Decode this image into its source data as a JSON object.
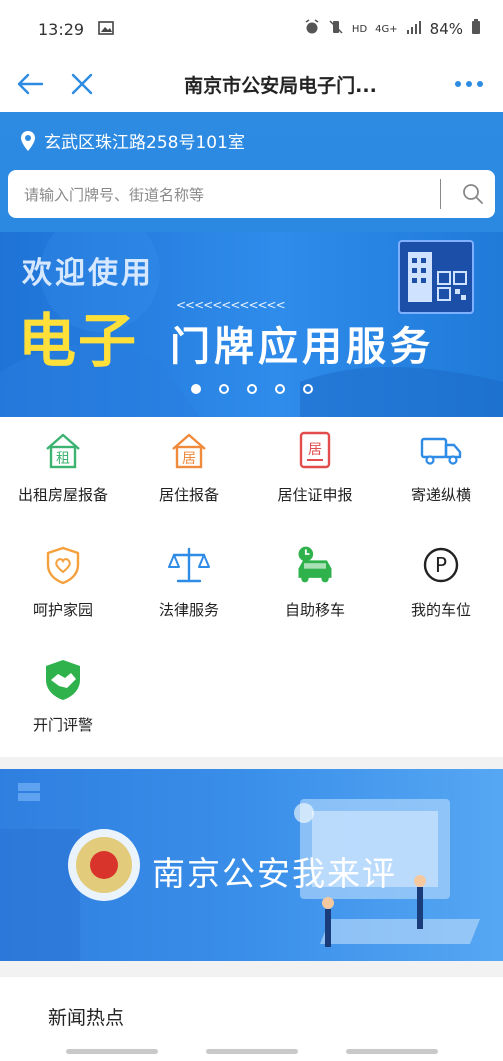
{
  "status_bar": {
    "time": "13:29",
    "battery": "84%",
    "network": "4G+",
    "hd": "HD"
  },
  "app_bar": {
    "title": "南京市公安局电子门..."
  },
  "header": {
    "address": "玄武区珠江路258号101室",
    "search_placeholder": "请输入门牌号、街道名称等"
  },
  "banner": {
    "welcome": "欢迎使用",
    "title_big": "电子",
    "title_rest": "门牌应用服务",
    "chevrons": "<<<<<<<<<<<<",
    "page_count": 5,
    "active_page": 1
  },
  "services": [
    {
      "label": "出租房屋报备",
      "icon": "house-rent-icon",
      "color": "#3cb371"
    },
    {
      "label": "居住报备",
      "icon": "house-reside-icon",
      "color": "#f08a3c"
    },
    {
      "label": "居住证申报",
      "icon": "residence-permit-icon",
      "color": "#e24c4c"
    },
    {
      "label": "寄递纵横",
      "icon": "delivery-truck-icon",
      "color": "#2e8be6"
    },
    {
      "label": "呵护家园",
      "icon": "heart-shield-icon",
      "color": "#f5a03c"
    },
    {
      "label": "法律服务",
      "icon": "scales-icon",
      "color": "#2e8be6"
    },
    {
      "label": "自助移车",
      "icon": "car-clock-icon",
      "color": "#2fb24c"
    },
    {
      "label": "我的车位",
      "icon": "parking-icon",
      "color": "#222222"
    },
    {
      "label": "开门评警",
      "icon": "handshake-icon",
      "color": "#2fb24c"
    }
  ],
  "eval_banner": {
    "text": "南京公安我来评"
  },
  "news": {
    "title": "新闻热点"
  }
}
